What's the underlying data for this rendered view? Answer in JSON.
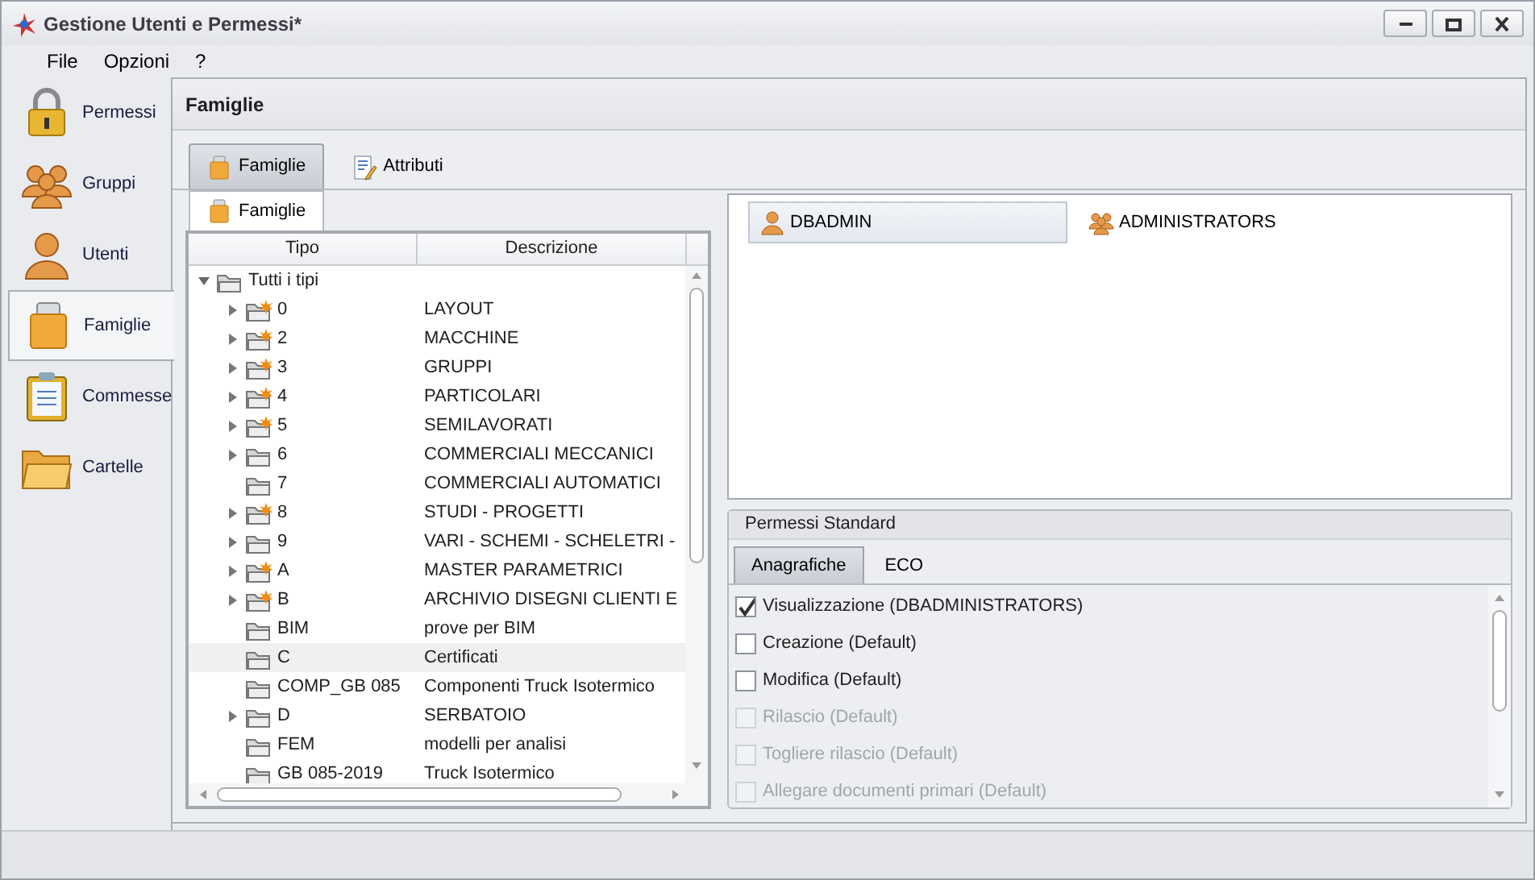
{
  "window": {
    "title": "Gestione Utenti e Permessi*"
  },
  "menu": [
    "File",
    "Opzioni",
    "?"
  ],
  "sidebar": {
    "items": [
      {
        "label": "Permessi",
        "selected": false
      },
      {
        "label": "Gruppi",
        "selected": false
      },
      {
        "label": "Utenti",
        "selected": false
      },
      {
        "label": "Famiglie",
        "selected": true
      },
      {
        "label": "Commesse",
        "selected": false
      },
      {
        "label": "Cartelle",
        "selected": false
      }
    ]
  },
  "header": "Famiglie",
  "tabs": [
    {
      "label": "Famiglie",
      "selected": true
    },
    {
      "label": "Attributi",
      "selected": false
    }
  ],
  "subtab": {
    "label": "Famiglie"
  },
  "tree": {
    "columns": [
      "Tipo",
      "Descrizione"
    ],
    "rows": [
      {
        "tipo": "Tutti i tipi",
        "descrizione": "",
        "kind": "folder",
        "expandable": true,
        "expanded": true,
        "selected": false,
        "children": [
          {
            "tipo": "0",
            "descrizione": "LAYOUT",
            "kind": "star-folder",
            "expandable": true,
            "selected": false
          },
          {
            "tipo": "2",
            "descrizione": "MACCHINE",
            "kind": "star-folder",
            "expandable": true,
            "selected": false
          },
          {
            "tipo": "3",
            "descrizione": "GRUPPI",
            "kind": "star-folder",
            "expandable": true,
            "selected": false
          },
          {
            "tipo": "4",
            "descrizione": "PARTICOLARI",
            "kind": "star-folder",
            "expandable": true,
            "selected": false
          },
          {
            "tipo": "5",
            "descrizione": "SEMILAVORATI",
            "kind": "star-folder",
            "expandable": true,
            "selected": false
          },
          {
            "tipo": "6",
            "descrizione": "COMMERCIALI MECCANICI",
            "kind": "folder",
            "expandable": true,
            "selected": false
          },
          {
            "tipo": "7",
            "descrizione": "COMMERCIALI AUTOMATICI",
            "kind": "folder",
            "expandable": false,
            "selected": false
          },
          {
            "tipo": "8",
            "descrizione": "STUDI - PROGETTI",
            "kind": "star-folder",
            "expandable": true,
            "selected": false
          },
          {
            "tipo": "9",
            "descrizione": "VARI - SCHEMI - SCHELETRI -",
            "kind": "folder",
            "expandable": true,
            "selected": false
          },
          {
            "tipo": "A",
            "descrizione": "MASTER PARAMETRICI",
            "kind": "star-folder",
            "expandable": true,
            "selected": false
          },
          {
            "tipo": "B",
            "descrizione": "ARCHIVIO DISEGNI CLIENTI E",
            "kind": "star-folder",
            "expandable": true,
            "selected": false
          },
          {
            "tipo": "BIM",
            "descrizione": "prove per BIM",
            "kind": "folder",
            "expandable": false,
            "selected": false
          },
          {
            "tipo": "C",
            "descrizione": "Certificati",
            "kind": "folder",
            "expandable": false,
            "selected": true
          },
          {
            "tipo": "COMP_GB 085",
            "descrizione": "Componenti Truck Isotermico",
            "kind": "folder",
            "expandable": false,
            "selected": false
          },
          {
            "tipo": "D",
            "descrizione": "SERBATOIO",
            "kind": "folder",
            "expandable": true,
            "selected": false
          },
          {
            "tipo": "FEM",
            "descrizione": "modelli per analisi",
            "kind": "folder",
            "expandable": false,
            "selected": false
          },
          {
            "tipo": "GB 085-2019",
            "descrizione": "Truck Isotermico",
            "kind": "folder",
            "expandable": false,
            "selected": false
          }
        ]
      }
    ]
  },
  "principals": [
    {
      "label": "DBADMIN",
      "kind": "user",
      "selected": true
    },
    {
      "label": "ADMINISTRATORS",
      "kind": "group",
      "selected": false
    }
  ],
  "permissions": {
    "title": "Permessi Standard",
    "tabs": [
      {
        "label": "Anagrafiche",
        "selected": true
      },
      {
        "label": "ECO",
        "selected": false
      }
    ],
    "items": [
      {
        "label": "Visualizzazione (DBADMINISTRATORS)",
        "checked": true,
        "disabled": false
      },
      {
        "label": "Creazione (Default)",
        "checked": false,
        "disabled": false
      },
      {
        "label": "Modifica (Default)",
        "checked": false,
        "disabled": false
      },
      {
        "label": "Rilascio (Default)",
        "checked": false,
        "disabled": true
      },
      {
        "label": "Togliere rilascio (Default)",
        "checked": false,
        "disabled": true
      },
      {
        "label": "Allegare documenti primari (Default)",
        "checked": false,
        "disabled": true
      }
    ]
  }
}
